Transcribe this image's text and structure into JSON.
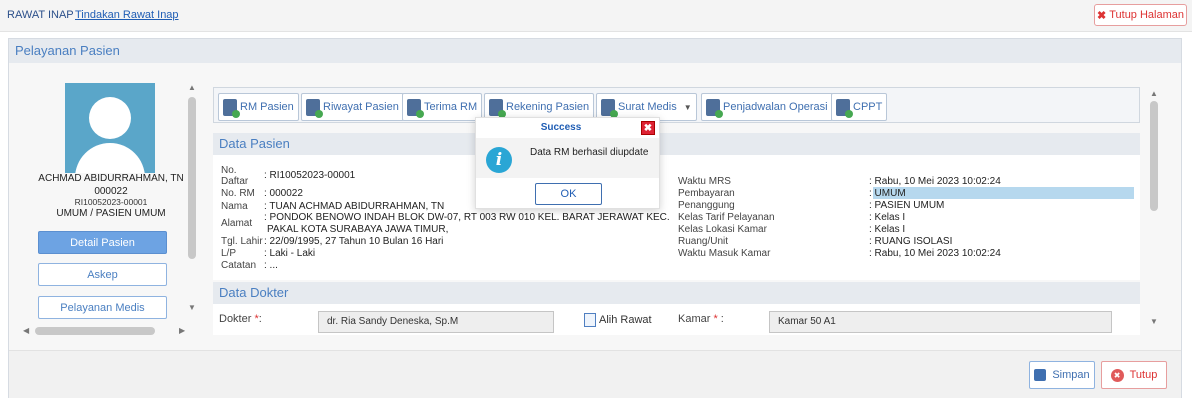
{
  "breadcrumb": {
    "root": "RAWAT INAP",
    "current": "Tindakan Rawat Inap"
  },
  "top_close": {
    "label": "Tutup Halaman",
    "icon": "close-x-icon",
    "color": "#dd3333"
  },
  "panel": {
    "title": "Pelayanan Pasien"
  },
  "patient": {
    "name": "ACHMAD ABIDURRAHMAN, TN",
    "code": "000022",
    "rm": "RI10052023-00001",
    "type": "UMUM / PASIEN UMUM"
  },
  "left_buttons": {
    "detail": "Detail Pasien",
    "askep": "Askep",
    "pelayanan": "Pelayanan Medis"
  },
  "toolbar": {
    "rm_pasien": "RM Pasien",
    "riwayat": "Riwayat Pasien",
    "terima_rm": "Terima RM",
    "rekening": "Rekening Pasien",
    "surat_medis": "Surat Medis",
    "penjadwalan": "Penjadwalan Operasi",
    "cppt": "CPPT"
  },
  "data_pasien": {
    "title": "Data Pasien",
    "no_daftar_label1": "No.",
    "no_daftar_label2": "Daftar",
    "no_daftar": ": RI10052023-00001",
    "no_rm_label": "No. RM",
    "no_rm": ": 000022",
    "nama_label": "Nama",
    "nama": ": TUAN ACHMAD ABIDURRAHMAN, TN",
    "alamat_label": "Alamat",
    "alamat1": ": PONDOK BENOWO INDAH BLOK DW-07, RT 003 RW 010 KEL. BARAT JERAWAT KEC.",
    "alamat2": "PAKAL KOTA SURABAYA JAWA TIMUR,",
    "tgl_lahir_label": "Tgl. Lahir",
    "tgl_lahir": ": 22/09/1995, 27 Tahun 10 Bulan 16 Hari",
    "lp_label": "L/P",
    "lp": ": Laki - Laki",
    "catatan_label": "Catatan",
    "catatan": ": ...",
    "waktu_mrs_label": "Waktu MRS",
    "waktu_mrs": ": Rabu, 10 Mei 2023 10:02:24",
    "pembayaran_label": "Pembayaran",
    "pembayaran": ": UMUM",
    "penanggung_label": "Penanggung",
    "penanggung": ": PASIEN UMUM",
    "kelas_tarif_label": "Kelas Tarif Pelayanan",
    "kelas_tarif": ": Kelas I",
    "kelas_lokasi_label": "Kelas Lokasi Kamar",
    "kelas_lokasi": ": Kelas I",
    "ruang_label": "Ruang/Unit",
    "ruang": ": RUANG ISOLASI",
    "waktu_masuk_label": "Waktu Masuk Kamar",
    "waktu_masuk": ": Rabu, 10 Mei 2023 10:02:24"
  },
  "data_dokter": {
    "title": "Data Dokter",
    "dokter_label": "Dokter",
    "dokter": "dr. Ria Sandy Deneska, Sp.M",
    "alih_rawat": "Alih Rawat",
    "kamar_label": "Kamar",
    "kamar": "Kamar 50 A1"
  },
  "modal": {
    "title": "Success",
    "message": "Data RM berhasil diupdate",
    "ok": "OK",
    "close": "✖"
  },
  "footer": {
    "simpan": "Simpan",
    "tutup": "Tutup"
  },
  "colors": {
    "accent": "#4a7fc1",
    "danger": "#dd3333",
    "info": "#2aa6d5",
    "highlight": "#b6d8ee"
  }
}
